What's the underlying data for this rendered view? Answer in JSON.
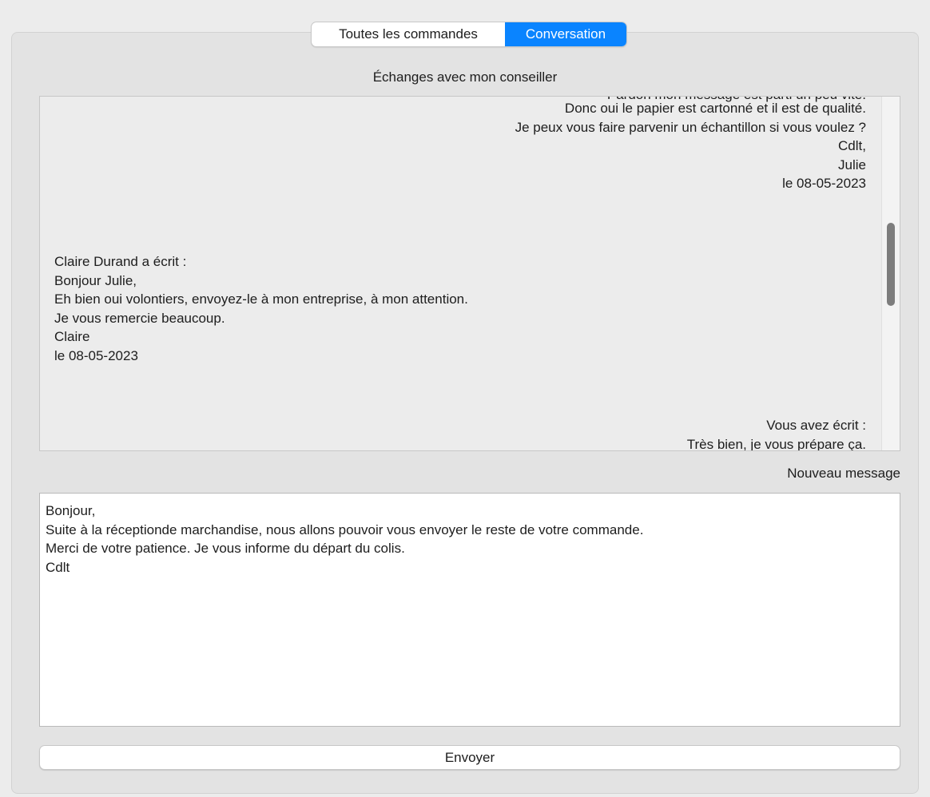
{
  "tabs": [
    {
      "label": "Toutes les commandes",
      "selected": false
    },
    {
      "label": "Conversation",
      "selected": true
    }
  ],
  "conversation_title": "Échanges avec mon conseiller",
  "messages": {
    "partial_top": "Pardon mon message est parti un peu vite.",
    "julie": "Donc oui le papier est cartonné et il est de qualité.\nJe peux vous faire parvenir un échantillon si vous voulez ?\nCdlt,\nJulie\nle 08-05-2023",
    "claire": "Claire Durand a écrit :\nBonjour Julie,\nEh bien oui volontiers, envoyez-le à mon entreprise, à mon attention.\nJe vous remercie beaucoup.\nClaire\nle 08-05-2023",
    "vous": "Vous avez écrit :\nTrès bien, je vous prépare ça."
  },
  "new_message_label": "Nouveau message",
  "compose_text": "Bonjour,\nSuite à la réceptionde marchandise, nous allons pouvoir vous envoyer le reste de votre commande.\nMerci de votre patience. Je vous informe du départ du colis.\nCdlt",
  "send_label": "Envoyer",
  "colors": {
    "accent": "#0a84ff",
    "window_bg": "#ececec",
    "panel_bg": "#e3e3e3"
  }
}
